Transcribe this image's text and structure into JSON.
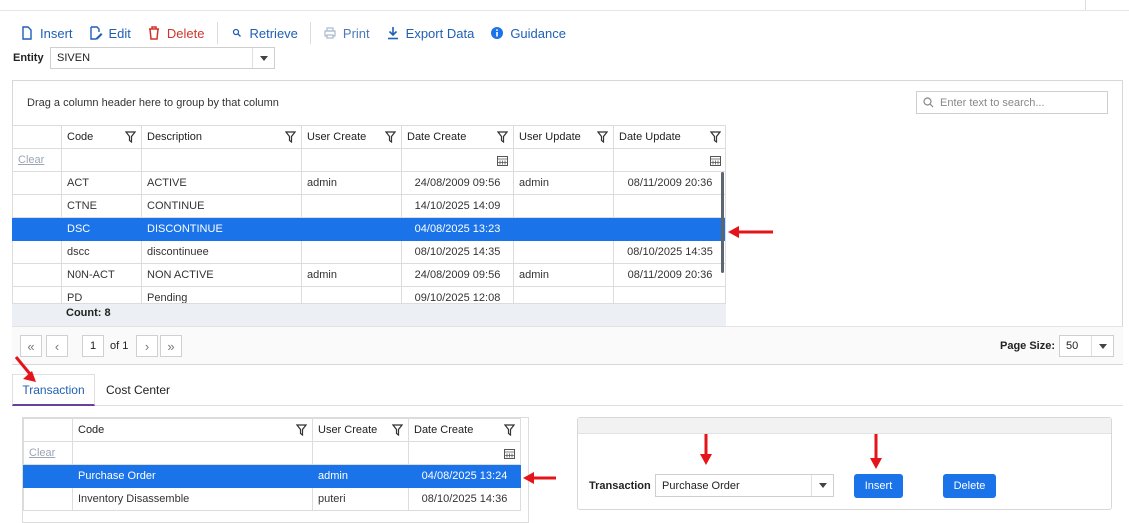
{
  "toolbar": {
    "insert": "Insert",
    "edit": "Edit",
    "delete": "Delete",
    "retrieve": "Retrieve",
    "print": "Print",
    "export": "Export Data",
    "guidance": "Guidance"
  },
  "entity": {
    "label": "Entity",
    "value": "SIVEN"
  },
  "group_hint": "Drag a column header here to group by that column",
  "search": {
    "placeholder": "Enter text to search..."
  },
  "grid1": {
    "columns": [
      "Code",
      "Description",
      "User Create",
      "Date Create",
      "User Update",
      "Date Update"
    ],
    "clear": "Clear",
    "rows": [
      [
        "ACT",
        "ACTIVE",
        "admin",
        "24/08/2009 09:56",
        "admin",
        "08/11/2009 20:36"
      ],
      [
        "CTNE",
        "CONTINUE",
        "",
        "14/10/2025 14:09",
        "",
        ""
      ],
      [
        "DSC",
        "DISCONTINUE",
        "",
        "04/08/2025 13:23",
        "",
        ""
      ],
      [
        "dscc",
        "discontinuee",
        "",
        "08/10/2025 14:35",
        "",
        "08/10/2025 14:35"
      ],
      [
        "N0N-ACT",
        "NON ACTIVE",
        "admin",
        "24/08/2009 09:56",
        "admin",
        "08/11/2009 20:36"
      ],
      [
        "PD",
        "Pending",
        "",
        "09/10/2025 12:08",
        "",
        ""
      ]
    ],
    "selected_index": 2,
    "count": "Count: 8"
  },
  "pager": {
    "page": "1",
    "of": "of 1",
    "page_size_label": "Page Size:",
    "page_size": "50"
  },
  "tabs": [
    {
      "label": "Transaction"
    },
    {
      "label": "Cost Center"
    }
  ],
  "grid2": {
    "columns": [
      "Code",
      "User Create",
      "Date Create"
    ],
    "clear": "Clear",
    "rows": [
      [
        "Purchase Order",
        "admin",
        "04/08/2025 13:24"
      ],
      [
        "Inventory Disassemble",
        "puteri",
        "08/10/2025 14:36"
      ]
    ],
    "selected_index": 0
  },
  "form": {
    "transaction_label": "Transaction",
    "transaction_value": "Purchase Order",
    "insert": "Insert",
    "delete": "Delete"
  },
  "colors": {
    "accent": "#1a73e8",
    "link": "#1f5fb4",
    "danger": "#d0342c",
    "annotation_arrow": "#e5141a"
  }
}
